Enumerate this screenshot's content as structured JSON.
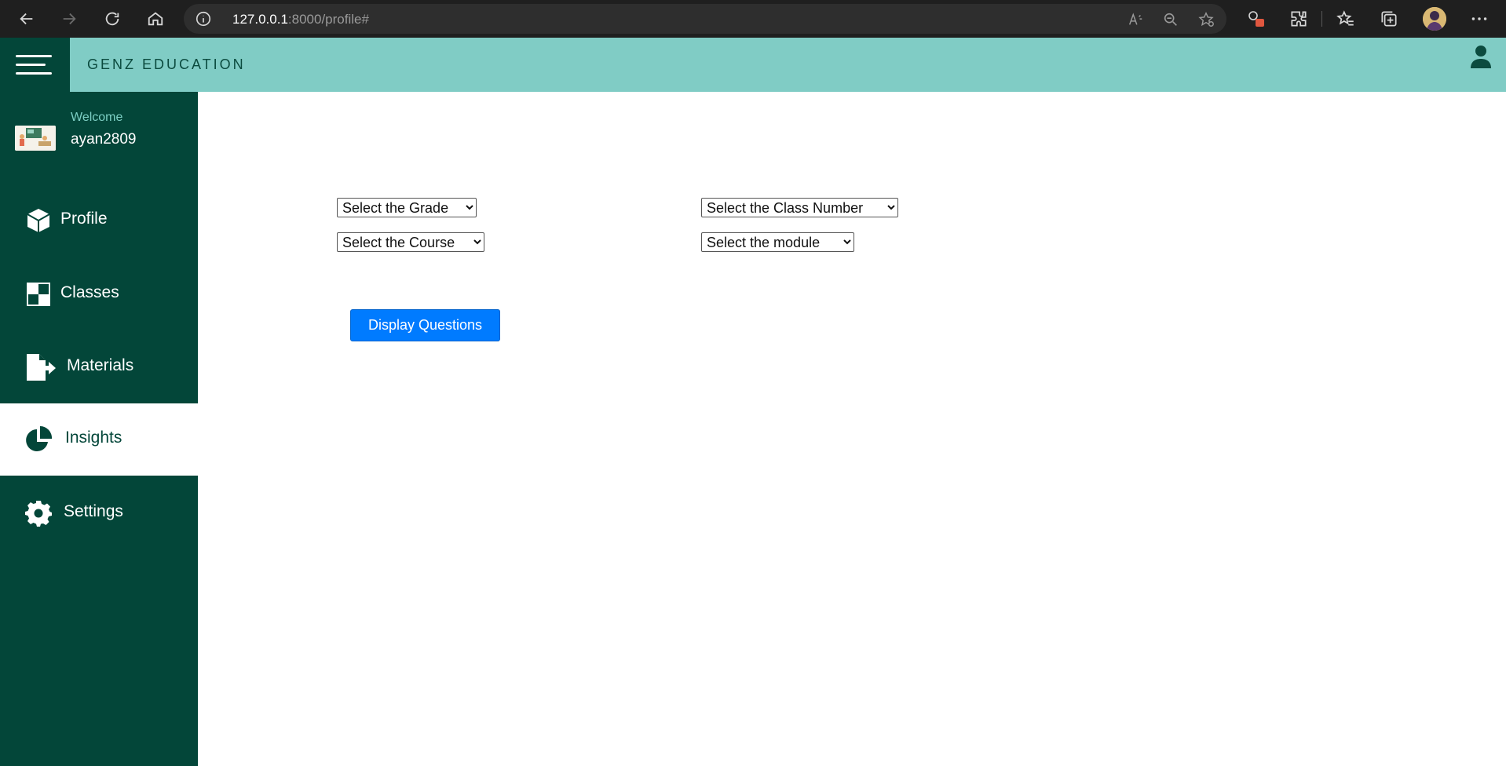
{
  "browser": {
    "url_host": "127.0.0.1",
    "url_rest": ":8000/profile#"
  },
  "header": {
    "brand": "GENZ EDUCATION",
    "colors": {
      "header_bg": "#80ccc5",
      "sidebar_bg": "#034639"
    }
  },
  "sidebar": {
    "welcome_label": "Welcome",
    "username": "ayan2809",
    "items": [
      {
        "label": "Profile",
        "icon": "cube-icon",
        "active": false
      },
      {
        "label": "Classes",
        "icon": "grid-icon",
        "active": false
      },
      {
        "label": "Materials",
        "icon": "file-export-icon",
        "active": false
      },
      {
        "label": "Insights",
        "icon": "pie-chart-icon",
        "active": true
      },
      {
        "label": "Settings",
        "icon": "gear-icon",
        "active": false
      }
    ]
  },
  "filters": {
    "grade": "Select the Grade",
    "class_number": "Select the Class Number",
    "course": "Select the Course",
    "module": "Select the module"
  },
  "actions": {
    "display_questions": "Display Questions",
    "primary_color": "#007bff"
  }
}
